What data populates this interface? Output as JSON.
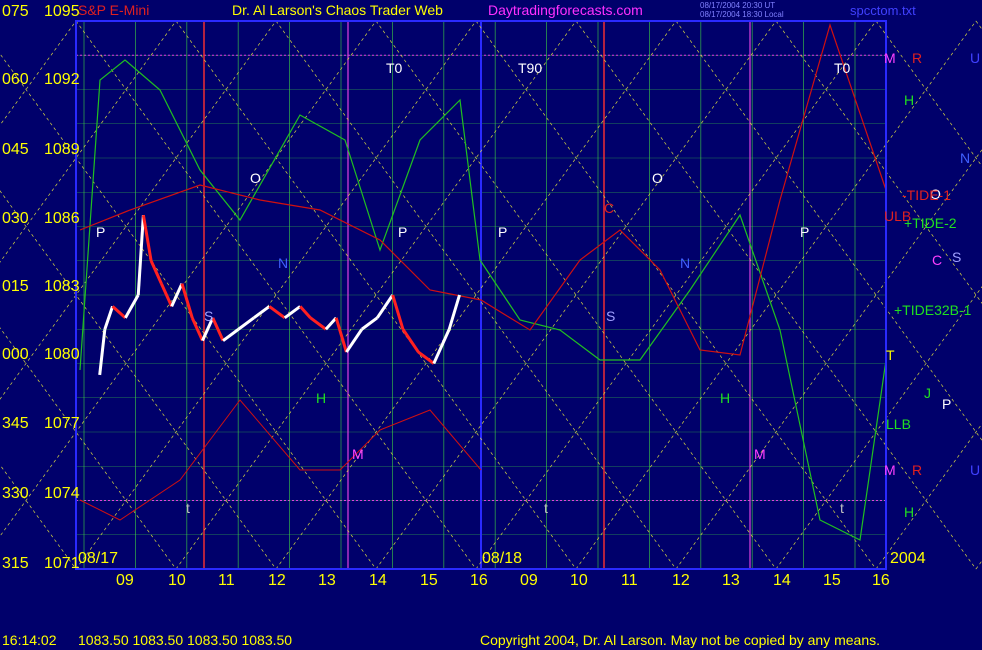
{
  "header": {
    "symbol": "S&P E-Mini",
    "author": "Dr. Al Larson's Chaos Trader Web",
    "site": "Daytradingforecasts.com",
    "stamp1": "08/17/2004 20:30 UT",
    "stamp2": "08/17/2004 18:30 Local",
    "file": "spcctom.txt"
  },
  "colors": {
    "background": "#00006b",
    "axis": "#2a2aff",
    "price_up": "#ffffff",
    "price_down": "#ff2020",
    "tide": "#20c020",
    "tide_red": "#d01010",
    "grid_green": "#40e040",
    "grid_yellow": "#d8d840",
    "magenta": "#e040e0"
  },
  "chart_data": {
    "type": "line",
    "title": "S&P E-Mini",
    "y_left_angles": [
      "075",
      "060",
      "045",
      "030",
      "015",
      "000",
      "345",
      "330",
      "315"
    ],
    "y_prices": [
      "1095",
      "1092",
      "1089",
      "1086",
      "1083",
      "1080",
      "1077",
      "1074",
      "1071"
    ],
    "ylim": [
      1071,
      1095
    ],
    "day1_label": "08/17",
    "day2_label": "08/18",
    "year_label": "2004",
    "hours_day1": [
      "09",
      "10",
      "11",
      "12",
      "13",
      "14",
      "15",
      "16"
    ],
    "hours_day2": [
      "09",
      "10",
      "11",
      "12",
      "13",
      "14",
      "15",
      "16"
    ],
    "price_series_08_17": [
      [
        9.0,
        1079.5
      ],
      [
        9.1,
        1081.5
      ],
      [
        9.25,
        1082.5
      ],
      [
        9.5,
        1082.0
      ],
      [
        9.75,
        1083.0
      ],
      [
        9.85,
        1086.5
      ],
      [
        10.0,
        1084.5
      ],
      [
        10.2,
        1083.5
      ],
      [
        10.4,
        1082.5
      ],
      [
        10.6,
        1083.5
      ],
      [
        10.8,
        1082.0
      ],
      [
        11.0,
        1081.0
      ],
      [
        11.2,
        1082.0
      ],
      [
        11.4,
        1081.0
      ],
      [
        11.7,
        1081.5
      ],
      [
        12.0,
        1082.0
      ],
      [
        12.3,
        1082.5
      ],
      [
        12.6,
        1082.0
      ],
      [
        12.9,
        1082.5
      ],
      [
        13.1,
        1082.0
      ],
      [
        13.4,
        1081.5
      ],
      [
        13.6,
        1082.0
      ],
      [
        13.8,
        1080.5
      ],
      [
        14.1,
        1081.5
      ],
      [
        14.4,
        1082.0
      ],
      [
        14.7,
        1083.0
      ],
      [
        14.9,
        1081.5
      ],
      [
        15.2,
        1080.5
      ],
      [
        15.5,
        1080.0
      ],
      [
        15.8,
        1081.5
      ],
      [
        16.0,
        1083.0
      ]
    ],
    "series": [
      {
        "name": "-TIDE-1",
        "color": "red"
      },
      {
        "name": "+TIDE-2",
        "color": "green"
      },
      {
        "name": "+TIDE32B-1",
        "color": "green"
      }
    ],
    "right_labels": {
      "m1": "M",
      "r1": "R",
      "u1": "U",
      "h1": "H",
      "n1": "N",
      "o1": "O",
      "tide1": "-TIDE-1",
      "ulb": "ULB",
      "tide2": "+TIDE-2",
      "c1": "C",
      "s1": "S",
      "tide32": "+TIDE32B-1",
      "t1": "T",
      "j1": "J",
      "p1": "P",
      "llb": "LLB",
      "m2": "M",
      "r2": "R",
      "u2": "U",
      "h2": "H"
    },
    "chart_labels": {
      "t0_a": "T0",
      "t90": "T90",
      "t0_b": "T0",
      "o_a": "O",
      "o_b": "O",
      "p_a": "P",
      "p_b": "P",
      "p_c": "P",
      "p_d": "P",
      "n_a": "N",
      "n_b": "N",
      "h_a": "H",
      "h_b": "H",
      "m_a": "M",
      "m_b": "M",
      "t_a": "t",
      "t_b": "t",
      "t_c": "t",
      "c_a": "C",
      "s_a": "S",
      "s_b": "S"
    }
  },
  "footer": {
    "time": "16:14:02",
    "ohlc": "1083.50 1083.50 1083.50 1083.50",
    "copyright": "Copyright 2004, Dr. Al Larson. May not be copied by any means."
  }
}
